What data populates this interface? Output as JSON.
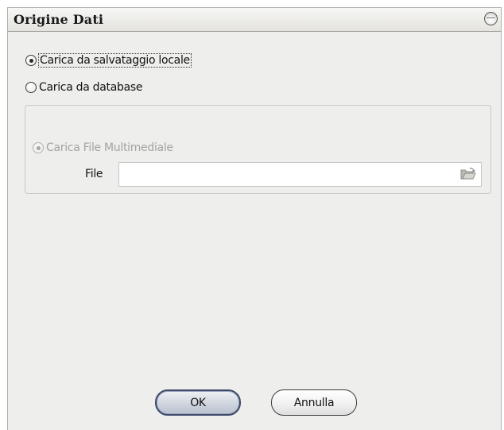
{
  "dialog": {
    "title": "Origine Dati",
    "collapse_icon": "circle-collapse-icon"
  },
  "source_options": [
    {
      "label": "Carica da salvataggio locale",
      "selected": true
    },
    {
      "label": "Carica da database",
      "selected": false
    }
  ],
  "local_group": {
    "option_label": "Carica File Multimediale",
    "option_selected": true,
    "option_enabled": false,
    "file_label": "File",
    "file_value": "",
    "browse_icon": "open-folder-icon"
  },
  "buttons": {
    "ok_label": "OK",
    "cancel_label": "Annulla"
  }
}
